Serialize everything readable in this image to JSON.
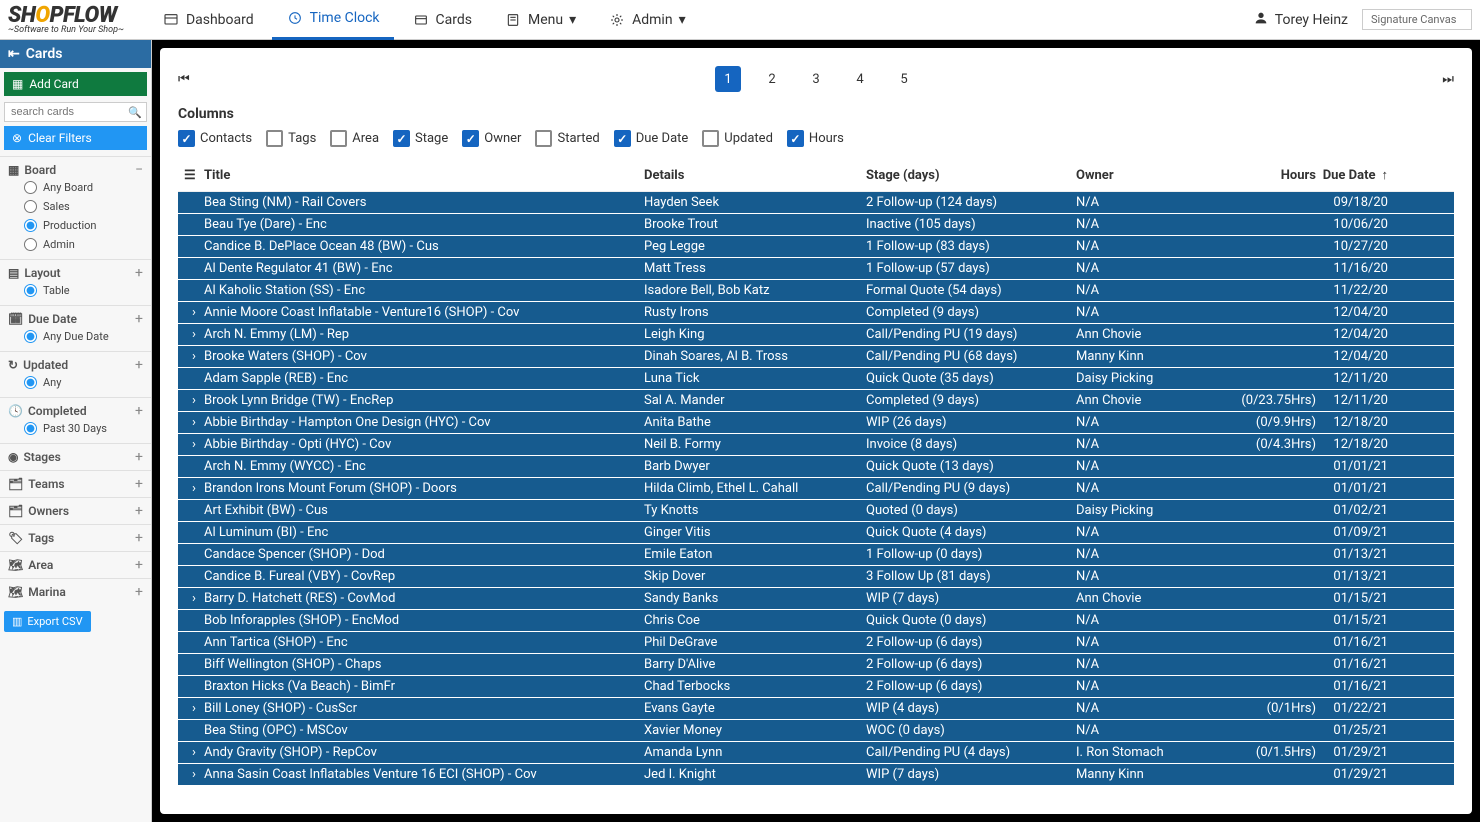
{
  "brand": {
    "name_part1": "SH",
    "name_y": "O",
    "name_part2": "PFLOW",
    "tagline": "~Software to Run Your Shop~"
  },
  "nav": {
    "dashboard": "Dashboard",
    "timeclock": "Time Clock",
    "cards": "Cards",
    "menu": "Menu",
    "admin": "Admin"
  },
  "user": {
    "name": "Torey Heinz",
    "sig_label": "Signature Canvas"
  },
  "sidebar": {
    "title": "Cards",
    "add_card": "Add Card",
    "search_placeholder": "search cards",
    "clear_filters": "Clear Filters",
    "export_csv": "Export CSV",
    "sections": {
      "board": {
        "label": "Board",
        "items": [
          "Any Board",
          "Sales",
          "Production",
          "Admin"
        ],
        "selected": "Production"
      },
      "layout": {
        "label": "Layout",
        "items": [
          "Table"
        ],
        "selected": "Table"
      },
      "due_date": {
        "label": "Due Date",
        "items": [
          "Any Due Date"
        ],
        "selected": "Any Due Date"
      },
      "updated": {
        "label": "Updated",
        "items": [
          "Any"
        ],
        "selected": "Any"
      },
      "completed": {
        "label": "Completed",
        "items": [
          "Past 30 Days"
        ],
        "selected": "Past 30 Days"
      },
      "stages": {
        "label": "Stages"
      },
      "teams": {
        "label": "Teams"
      },
      "owners": {
        "label": "Owners"
      },
      "tags": {
        "label": "Tags"
      },
      "area": {
        "label": "Area"
      },
      "marina": {
        "label": "Marina"
      }
    }
  },
  "pager": {
    "pages": [
      "1",
      "2",
      "3",
      "4",
      "5"
    ],
    "current": "1"
  },
  "columns_header": "Columns",
  "column_toggles": [
    {
      "label": "Contacts",
      "on": true
    },
    {
      "label": "Tags",
      "on": false
    },
    {
      "label": "Area",
      "on": false
    },
    {
      "label": "Stage",
      "on": true
    },
    {
      "label": "Owner",
      "on": true
    },
    {
      "label": "Started",
      "on": false
    },
    {
      "label": "Due Date",
      "on": true
    },
    {
      "label": "Updated",
      "on": false
    },
    {
      "label": "Hours",
      "on": true
    }
  ],
  "table": {
    "headers": {
      "title": "Title",
      "details": "Details",
      "stage": "Stage (days)",
      "owner": "Owner",
      "hours": "Hours",
      "due": "Due Date"
    },
    "rows": [
      {
        "exp": false,
        "title": "Bea Sting (NM) - Rail Covers",
        "details": "Hayden Seek",
        "stage": "2 Follow-up (124 days)",
        "owner": "N/A",
        "hours": "",
        "due": "09/18/20"
      },
      {
        "exp": false,
        "title": "Beau Tye (Dare) - Enc",
        "details": "Brooke Trout",
        "stage": "Inactive (105 days)",
        "owner": "N/A",
        "hours": "",
        "due": "10/06/20"
      },
      {
        "exp": false,
        "title": "Candice B. DePlace Ocean 48 (BW) - Cus",
        "details": "Peg Legge",
        "stage": "1 Follow-up (83 days)",
        "owner": "N/A",
        "hours": "",
        "due": "10/27/20"
      },
      {
        "exp": false,
        "title": "Al Dente Regulator 41 (BW) - Enc",
        "details": "Matt Tress",
        "stage": "1 Follow-up (57 days)",
        "owner": "N/A",
        "hours": "",
        "due": "11/16/20"
      },
      {
        "exp": false,
        "title": "Al Kaholic Station (SS) - Enc",
        "details": "Isadore Bell, Bob Katz",
        "stage": "Formal Quote (54 days)",
        "owner": "N/A",
        "hours": "",
        "due": "11/22/20"
      },
      {
        "exp": true,
        "title": "Annie Moore Coast Inflatable - Venture16 (SHOP) - Cov",
        "details": "Rusty Irons",
        "stage": "Completed (9 days)",
        "owner": "N/A",
        "hours": "",
        "due": "12/04/20"
      },
      {
        "exp": true,
        "title": "Arch N. Emmy (LM) - Rep",
        "details": "Leigh King",
        "stage": "Call/Pending PU (19 days)",
        "owner": "Ann Chovie",
        "hours": "",
        "due": "12/04/20"
      },
      {
        "exp": true,
        "title": "Brooke Waters (SHOP) - Cov",
        "details": "Dinah Soares, Al B. Tross",
        "stage": "Call/Pending PU (68 days)",
        "owner": "Manny Kinn",
        "hours": "",
        "due": "12/04/20"
      },
      {
        "exp": false,
        "title": "Adam Sapple (REB) - Enc",
        "details": "Luna Tick",
        "stage": "Quick Quote (35 days)",
        "owner": "Daisy Picking",
        "hours": "",
        "due": "12/11/20"
      },
      {
        "exp": true,
        "title": "Brook Lynn Bridge (TW) - EncRep",
        "details": "Sal A. Mander",
        "stage": "Completed (9 days)",
        "owner": "Ann Chovie",
        "hours": "(0/23.75Hrs)",
        "due": "12/11/20"
      },
      {
        "exp": true,
        "title": "Abbie Birthday - Hampton One Design (HYC) - Cov",
        "details": "Anita Bathe",
        "stage": "WIP (26 days)",
        "owner": "N/A",
        "hours": "(0/9.9Hrs)",
        "due": "12/18/20"
      },
      {
        "exp": true,
        "title": "Abbie Birthday - Opti (HYC) - Cov",
        "details": "Neil B. Formy",
        "stage": "Invoice (8 days)",
        "owner": "N/A",
        "hours": "(0/4.3Hrs)",
        "due": "12/18/20"
      },
      {
        "exp": false,
        "title": "Arch N. Emmy (WYCC) - Enc",
        "details": "Barb Dwyer",
        "stage": "Quick Quote (13 days)",
        "owner": "N/A",
        "hours": "",
        "due": "01/01/21"
      },
      {
        "exp": true,
        "title": "Brandon Irons Mount Forum (SHOP) - Doors",
        "details": "Hilda Climb, Ethel L. Cahall",
        "stage": "Call/Pending PU (9 days)",
        "owner": "N/A",
        "hours": "",
        "due": "01/01/21"
      },
      {
        "exp": false,
        "title": "Art Exhibit (BW) - Cus",
        "details": "Ty Knotts",
        "stage": "Quoted (0 days)",
        "owner": "Daisy Picking",
        "hours": "",
        "due": "01/02/21"
      },
      {
        "exp": false,
        "title": "Al Luminum (BI) - Enc",
        "details": "Ginger Vitis",
        "stage": "Quick Quote (4 days)",
        "owner": "N/A",
        "hours": "",
        "due": "01/09/21"
      },
      {
        "exp": false,
        "title": "Candace Spencer (SHOP) - Dod",
        "details": "Emile Eaton",
        "stage": "1 Follow-up (0 days)",
        "owner": "N/A",
        "hours": "",
        "due": "01/13/21"
      },
      {
        "exp": false,
        "title": "Candice B. Fureal (VBY) - CovRep",
        "details": "Skip Dover",
        "stage": "3 Follow Up (81 days)",
        "owner": "N/A",
        "hours": "",
        "due": "01/13/21"
      },
      {
        "exp": true,
        "title": "Barry D. Hatchett (RES) - CovMod",
        "details": "Sandy Banks",
        "stage": "WIP (7 days)",
        "owner": "Ann Chovie",
        "hours": "",
        "due": "01/15/21"
      },
      {
        "exp": false,
        "title": "Bob Inforapples (SHOP) - EncMod",
        "details": "Chris Coe",
        "stage": "Quick Quote (0 days)",
        "owner": "N/A",
        "hours": "",
        "due": "01/15/21"
      },
      {
        "exp": false,
        "title": "Ann Tartica (SHOP) - Enc",
        "details": "Phil DeGrave",
        "stage": "2 Follow-up (6 days)",
        "owner": "N/A",
        "hours": "",
        "due": "01/16/21"
      },
      {
        "exp": false,
        "title": "Biff Wellington (SHOP) - Chaps",
        "details": "Barry D'Alive",
        "stage": "2 Follow-up (6 days)",
        "owner": "N/A",
        "hours": "",
        "due": "01/16/21"
      },
      {
        "exp": false,
        "title": "Braxton Hicks (Va Beach) - BimFr",
        "details": "Chad Terbocks",
        "stage": "2 Follow-up (6 days)",
        "owner": "N/A",
        "hours": "",
        "due": "01/16/21"
      },
      {
        "exp": true,
        "title": "Bill Loney (SHOP) - CusScr",
        "details": "Evans Gayte",
        "stage": "WIP (4 days)",
        "owner": "N/A",
        "hours": "(0/1Hrs)",
        "due": "01/22/21"
      },
      {
        "exp": false,
        "title": "Bea Sting (OPC) - MSCov",
        "details": "Xavier Money",
        "stage": "WOC (0 days)",
        "owner": "N/A",
        "hours": "",
        "due": "01/25/21"
      },
      {
        "exp": true,
        "title": "Andy Gravity (SHOP) - RepCov",
        "details": "Amanda Lynn",
        "stage": "Call/Pending PU (4 days)",
        "owner": "I. Ron Stomach",
        "hours": "(0/1.5Hrs)",
        "due": "01/29/21"
      },
      {
        "exp": true,
        "title": "Anna Sasin Coast Inflatables Venture 16 ECI (SHOP) - Cov",
        "details": "Jed I. Knight",
        "stage": "WIP (7 days)",
        "owner": "Manny Kinn",
        "hours": "",
        "due": "01/29/21"
      }
    ]
  }
}
